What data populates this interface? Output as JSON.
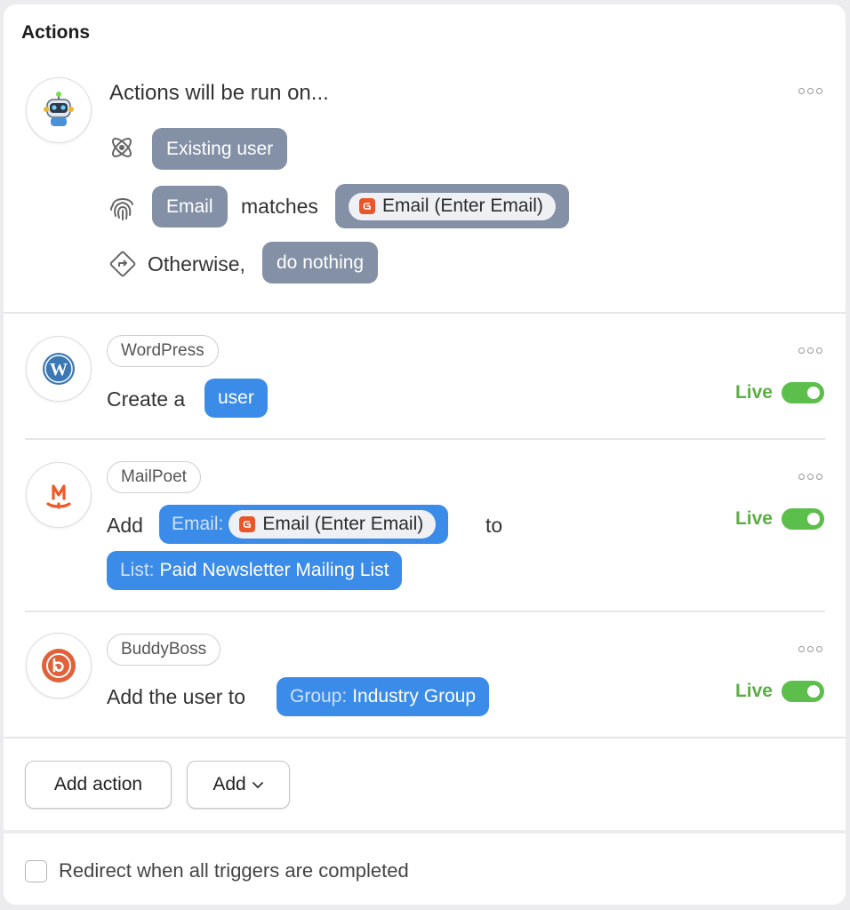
{
  "header": {
    "title": "Actions"
  },
  "conditions": {
    "intro": "Actions will be run on...",
    "user_type": "Existing user",
    "match_field": "Email",
    "match_word": "matches",
    "match_value": "Email (Enter Email)",
    "otherwise_label": "Otherwise,",
    "otherwise_value": "do nothing"
  },
  "actions": [
    {
      "integration": "WordPress",
      "text_prefix": "Create a",
      "token": "user",
      "status": "Live"
    },
    {
      "integration": "MailPoet",
      "text_prefix": "Add",
      "token1_label": "Email:",
      "token1_value": "Email (Enter Email)",
      "text_mid": "to",
      "token2_label": "List:",
      "token2_value": "Paid Newsletter Mailing List",
      "status": "Live"
    },
    {
      "integration": "BuddyBoss",
      "text_prefix": "Add the user to",
      "token_label": "Group:",
      "token_value": "Industry Group",
      "status": "Live"
    }
  ],
  "buttons": {
    "add_action": "Add action",
    "add": "Add"
  },
  "footer": {
    "redirect_label": "Redirect when all triggers are completed"
  },
  "colors": {
    "gray_pill": "#8390a6",
    "blue_pill": "#3b8be8",
    "live": "#5cae44"
  }
}
